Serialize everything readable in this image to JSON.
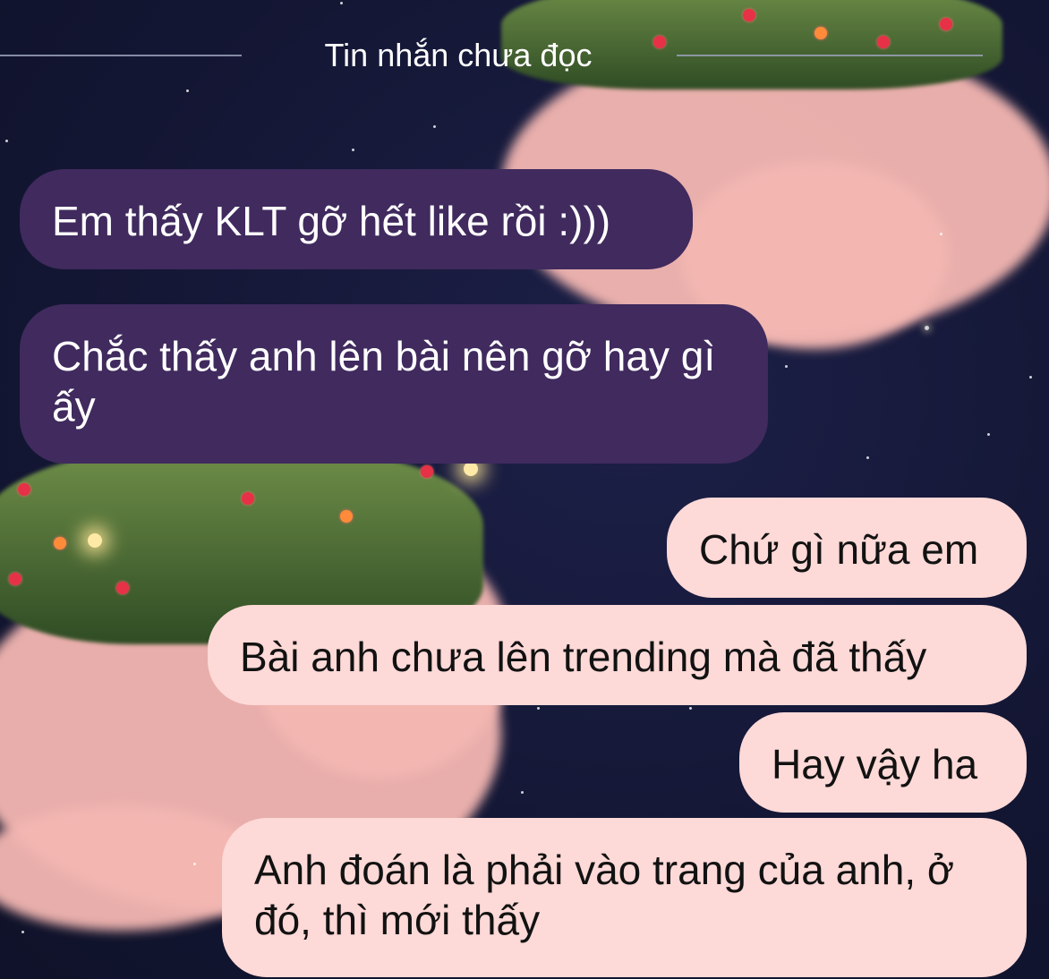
{
  "divider": {
    "label": "Tin nhắn chưa đọc"
  },
  "messages": [
    {
      "direction": "incoming",
      "text": "Em thấy KLT gỡ hết like rồi :)))"
    },
    {
      "direction": "incoming",
      "text": "Chắc thấy anh lên bài nên gỡ hay gì ấy"
    },
    {
      "direction": "outgoing",
      "text": "Chứ gì nữa em"
    },
    {
      "direction": "outgoing",
      "text": "Bài anh chưa lên trending mà đã thấy"
    },
    {
      "direction": "outgoing",
      "text": "Hay vậy ha"
    },
    {
      "direction": "outgoing",
      "text": "Anh đoán là phải vào trang của anh, ở đó, thì mới thấy"
    }
  ],
  "theme": {
    "incoming_bubble": "#402a5e",
    "outgoing_bubble": "#fdd9d7",
    "background": "#141735",
    "cloud": "#f4b7b2"
  }
}
